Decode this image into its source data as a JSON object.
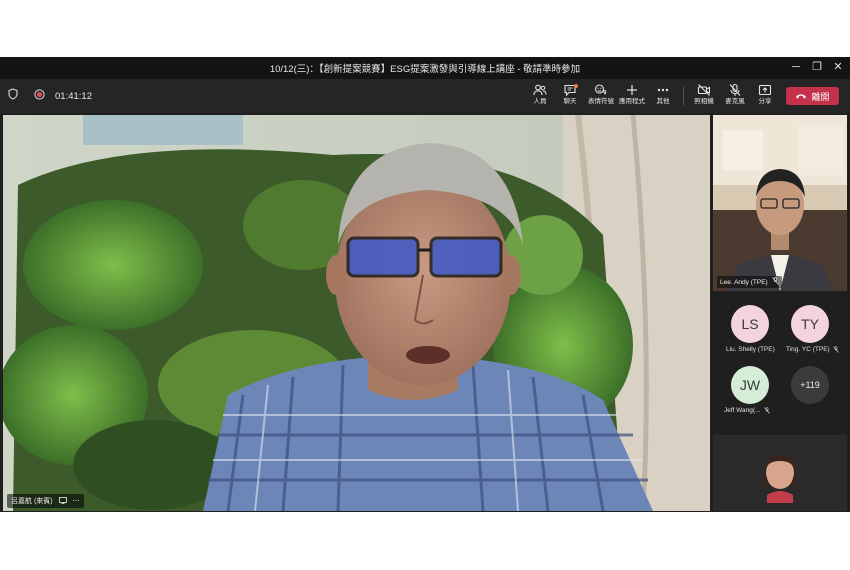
{
  "window": {
    "title": "10/12(三)：【創新提案競賽】ESG提案激發與引導線上講座 - 敬請準時參加",
    "minimize_glyph": "─",
    "restore_glyph": "❐",
    "close_glyph": "✕"
  },
  "toolbar": {
    "elapsed_time": "01:41:12",
    "buttons": [
      {
        "label": "人員",
        "icon": "people-icon"
      },
      {
        "label": "聊天",
        "icon": "chat-icon"
      },
      {
        "label": "表情符號",
        "icon": "reactions-icon"
      },
      {
        "label": "應用程式",
        "icon": "apps-plus-icon"
      },
      {
        "label": "其他",
        "icon": "more-dots-icon"
      },
      {
        "label": "照相機",
        "icon": "camera-off-icon"
      },
      {
        "label": "麥克風",
        "icon": "mic-off-icon"
      },
      {
        "label": "分享",
        "icon": "share-icon"
      }
    ],
    "leave_label": "離開",
    "colors": {
      "leave": "#c4314b",
      "toolbar": "#252525",
      "chat_badge": "#e8794a"
    }
  },
  "main_video": {
    "speaker_name": "呂嘉航 (來賓)"
  },
  "side_panel": {
    "featured": {
      "name": "Lee. Andy (TPE)"
    },
    "participants": [
      {
        "initials": "LS",
        "name": "Liu. Shelly (TPE)",
        "color": "#f3d3dc"
      },
      {
        "initials": "TY",
        "name": "Ting. YC (TPE)",
        "color": "#f3d3dc"
      },
      {
        "initials": "JW",
        "name": "Jeff Wang(...",
        "color": "#d5ecd6"
      }
    ],
    "overflow_count": "+119"
  }
}
